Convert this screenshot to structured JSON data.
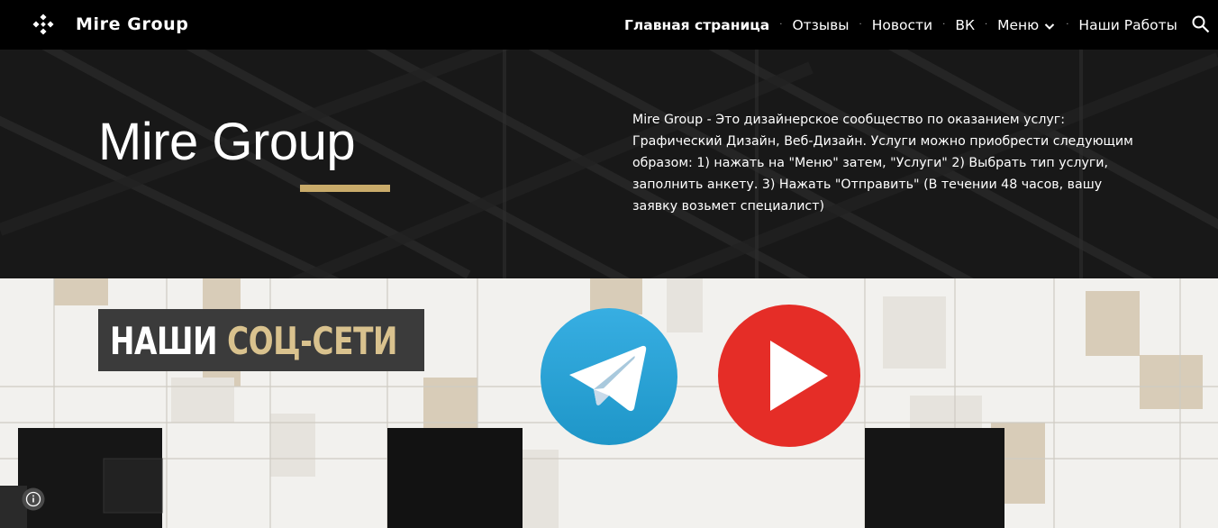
{
  "header": {
    "site_name": "Mire Group",
    "logo_icon": "diamond-grid-logo-icon",
    "nav": [
      {
        "label": "Главная страница",
        "active": true
      },
      {
        "label": "Отзывы",
        "active": false
      },
      {
        "label": "Новости",
        "active": false
      },
      {
        "label": "ВК",
        "active": false
      },
      {
        "label": "Меню",
        "active": false,
        "has_dropdown": true
      },
      {
        "label": "Наши Работы",
        "active": false
      }
    ],
    "separator": "·",
    "search_icon": "search-icon"
  },
  "hero": {
    "title": "Mire Group",
    "description": "Mire Group - Это дизайнерское сообщество по оказанием услуг: Графический Дизайн, Веб-Дизайн. Услуги можно приобрести следующим образом: 1) нажать на \"Меню\" затем, \"Услуги\" 2) Выбрать тип услуги, заполнить анкету. 3) Нажать \"Отправить\" (В течении 48 часов, вашу заявку возьмет специалист)",
    "accent_color": "#c9ab6a"
  },
  "social": {
    "heading_part1": "НАШИ",
    "heading_part2": "СОЦ-СЕТИ",
    "heading_gold_color": "#d9c28e",
    "links": [
      {
        "name": "telegram",
        "icon": "telegram-icon",
        "color": "#2ca5e0"
      },
      {
        "name": "youtube",
        "icon": "youtube-play-icon",
        "color": "#e52d27"
      }
    ],
    "info_icon": "info-icon"
  }
}
